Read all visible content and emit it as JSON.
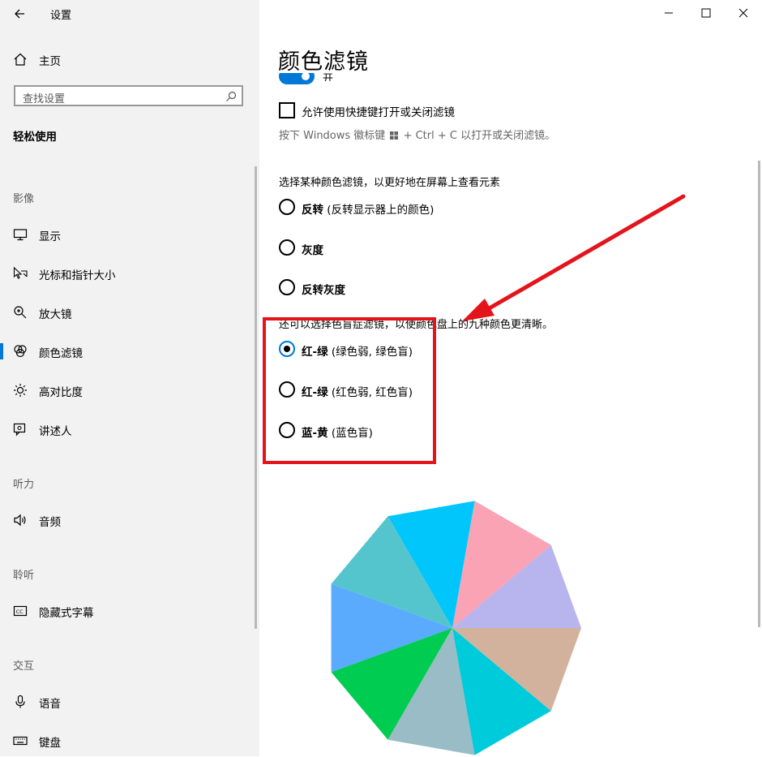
{
  "window": {
    "title": "设置"
  },
  "sidebar": {
    "home_label": "主页",
    "search_placeholder": "查找设置",
    "category": "轻松使用",
    "sections": [
      {
        "header": "影像",
        "items": [
          {
            "label": "显示",
            "icon": "monitor-icon"
          },
          {
            "label": "光标和指针大小",
            "icon": "cursor-icon"
          },
          {
            "label": "放大镜",
            "icon": "magnifier-icon"
          },
          {
            "label": "颜色滤镜",
            "icon": "color-filter-icon",
            "selected": true
          },
          {
            "label": "高对比度",
            "icon": "brightness-icon"
          },
          {
            "label": "讲述人",
            "icon": "narrator-icon"
          }
        ]
      },
      {
        "header": "听力",
        "items": [
          {
            "label": "音频",
            "icon": "speaker-icon"
          }
        ]
      },
      {
        "header": "聆听",
        "items": [
          {
            "label": "隐藏式字幕",
            "icon": "caption-icon"
          }
        ]
      },
      {
        "header": "交互",
        "items": [
          {
            "label": "语音",
            "icon": "microphone-icon"
          },
          {
            "label": "键盘",
            "icon": "keyboard-icon"
          }
        ]
      }
    ]
  },
  "main": {
    "title": "颜色滤镜",
    "toggle": {
      "label": "开",
      "on": true
    },
    "shortcut_checkbox": {
      "label": "允许使用快捷键打开或关闭滤镜",
      "checked": false
    },
    "hint_before": "按下 Windows 徽标键",
    "hint_after": "+ Ctrl + C 以打开或关闭滤镜。",
    "filter_heading": "选择某种颜色滤镜，以更好地在屏幕上查看元素",
    "filters": [
      {
        "name": "反转",
        "desc": "(反转显示器上的颜色)",
        "selected": false
      },
      {
        "name": "灰度",
        "desc": "",
        "selected": false
      },
      {
        "name": "反转灰度",
        "desc": "",
        "selected": false
      }
    ],
    "cvd_heading": "还可以选择色盲症滤镜，以使颜色盘上的九种颜色更清晰。",
    "cvd_filters": [
      {
        "name": "红-绿",
        "desc": "(绿色弱, 绿色盲)",
        "selected": true
      },
      {
        "name": "红-绿",
        "desc": "(红色弱, 红色盲)",
        "selected": false
      },
      {
        "name": "蓝-黄",
        "desc": "(蓝色盲)",
        "selected": false
      }
    ]
  },
  "color_wheel": {
    "colors": [
      "#b8b4ee",
      "#f9a3b4",
      "#00c6fb",
      "#54c5cc",
      "#5aabfe",
      "#00cc52",
      "#99bcc6",
      "#00cbda",
      "#d2b29c"
    ]
  },
  "colors": {
    "accent": "#0078d7",
    "annotation_red": "#e4141b",
    "sidebar_bg": "#f2f2f2"
  }
}
